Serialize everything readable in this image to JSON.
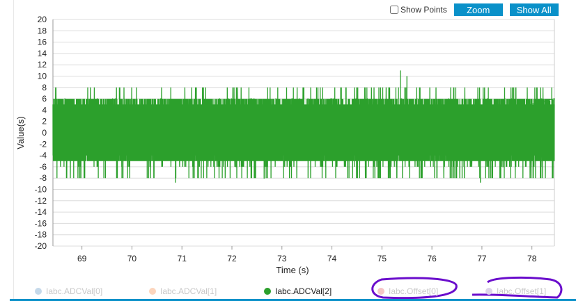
{
  "controls": {
    "show_points_label": "Show Points",
    "show_points_checked": false,
    "zoom_label": "Zoom",
    "show_all_label": "Show All"
  },
  "chart_data": {
    "type": "line",
    "xlabel": "Time (s)",
    "ylabel": "Value(s)",
    "xlim": [
      68.42,
      78.45
    ],
    "ylim": [
      -20,
      20
    ],
    "xticks": [
      69,
      70,
      71,
      72,
      73,
      74,
      75,
      76,
      77,
      78
    ],
    "yticks": [
      20,
      18,
      16,
      14,
      12,
      10,
      8,
      6,
      4,
      2,
      0,
      -2,
      -4,
      -6,
      -8,
      -10,
      -12,
      -14,
      -16,
      -18,
      -20
    ],
    "grid": true,
    "legend_position": "bottom",
    "series": [
      {
        "name": "Iabc.ADCVal[0]",
        "color": "#c5d9ea",
        "visible": false
      },
      {
        "name": "Iabc.ADCVal[1]",
        "color": "#fcd5bd",
        "visible": false
      },
      {
        "name": "Iabc.ADCVal[2]",
        "color": "#2ca02c",
        "visible": true,
        "noise": {
          "typical_band": [
            -5.5,
            6
          ],
          "occasional_extremes": [
            -8,
            8
          ],
          "samples_per_second": 140
        },
        "notable_points": [
          {
            "x": 75.37,
            "y": 11
          },
          {
            "x": 70.87,
            "y": -8.8
          },
          {
            "x": 76.97,
            "y": -8.8
          },
          {
            "x": 75.5,
            "y": 10
          },
          {
            "x": 69.8,
            "y": -8
          }
        ]
      },
      {
        "name": "Iabc.Offset[0]",
        "color": "#f5c6c7",
        "visible": false
      },
      {
        "name": "Iabc.Offset[1]",
        "color": "#ddd3ea",
        "visible": false
      }
    ],
    "annotation_color": "#6a0dcc"
  }
}
